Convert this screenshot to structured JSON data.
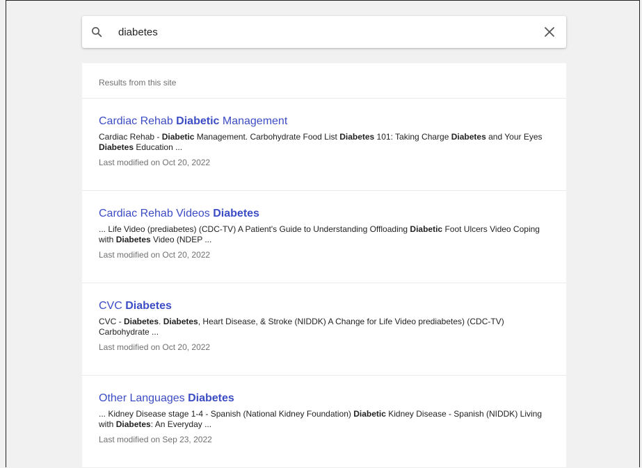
{
  "search": {
    "query": "diabetes"
  },
  "results_header": "Results from this site",
  "results": [
    {
      "title": [
        {
          "text": "Cardiac Rehab ",
          "bold": false
        },
        {
          "text": "Diabetic",
          "bold": true
        },
        {
          "text": " Management",
          "bold": false
        }
      ],
      "snippet": [
        {
          "text": "Cardiac Rehab - ",
          "bold": false
        },
        {
          "text": "Diabetic",
          "bold": true
        },
        {
          "text": " Management. Carbohydrate Food List ",
          "bold": false
        },
        {
          "text": "Diabetes",
          "bold": true
        },
        {
          "text": " 101: Taking Charge ",
          "bold": false
        },
        {
          "text": "Diabetes",
          "bold": true
        },
        {
          "text": " and Your Eyes ",
          "bold": false
        },
        {
          "text": "Diabetes",
          "bold": true
        },
        {
          "text": " Education ...",
          "bold": false
        }
      ],
      "modified": "Last modified on Oct 20, 2022"
    },
    {
      "title": [
        {
          "text": "Cardiac Rehab Videos ",
          "bold": false
        },
        {
          "text": "Diabetes",
          "bold": true
        }
      ],
      "snippet": [
        {
          "text": "... Life Video (prediabetes) (CDC-TV) A Patient's Guide to Understanding Offloading ",
          "bold": false
        },
        {
          "text": "Diabetic",
          "bold": true
        },
        {
          "text": " Foot Ulcers Video Coping with ",
          "bold": false
        },
        {
          "text": "Diabetes",
          "bold": true
        },
        {
          "text": " Video (NDEP ...",
          "bold": false
        }
      ],
      "modified": "Last modified on Oct 20, 2022"
    },
    {
      "title": [
        {
          "text": "CVC ",
          "bold": false
        },
        {
          "text": "Diabetes",
          "bold": true
        }
      ],
      "snippet": [
        {
          "text": "CVC - ",
          "bold": false
        },
        {
          "text": "Diabetes",
          "bold": true
        },
        {
          "text": ". ",
          "bold": false
        },
        {
          "text": "Diabetes",
          "bold": true
        },
        {
          "text": ", Heart Disease, & Stroke (NIDDK) A Change for Life Video prediabetes) (CDC-TV) Carbohydrate ...",
          "bold": false
        }
      ],
      "modified": "Last modified on Oct 20, 2022"
    },
    {
      "title": [
        {
          "text": "Other Languages ",
          "bold": false
        },
        {
          "text": "Diabetes",
          "bold": true
        }
      ],
      "snippet": [
        {
          "text": "... Kidney Disease stage 1-4 - Spanish (National Kidney Foundation) ",
          "bold": false
        },
        {
          "text": "Diabetic",
          "bold": true
        },
        {
          "text": " Kidney Disease - Spanish (NIDDK) Living with ",
          "bold": false
        },
        {
          "text": "Diabetes",
          "bold": true
        },
        {
          "text": ": An Everyday ...",
          "bold": false
        }
      ],
      "modified": "Last modified on Sep 23, 2022"
    }
  ],
  "colors": {
    "link": "#3c4cc4",
    "text": "#222222",
    "muted": "#707070",
    "background": "#f1f1f1"
  },
  "icons": {
    "search": "search-icon",
    "clear": "close-icon"
  }
}
